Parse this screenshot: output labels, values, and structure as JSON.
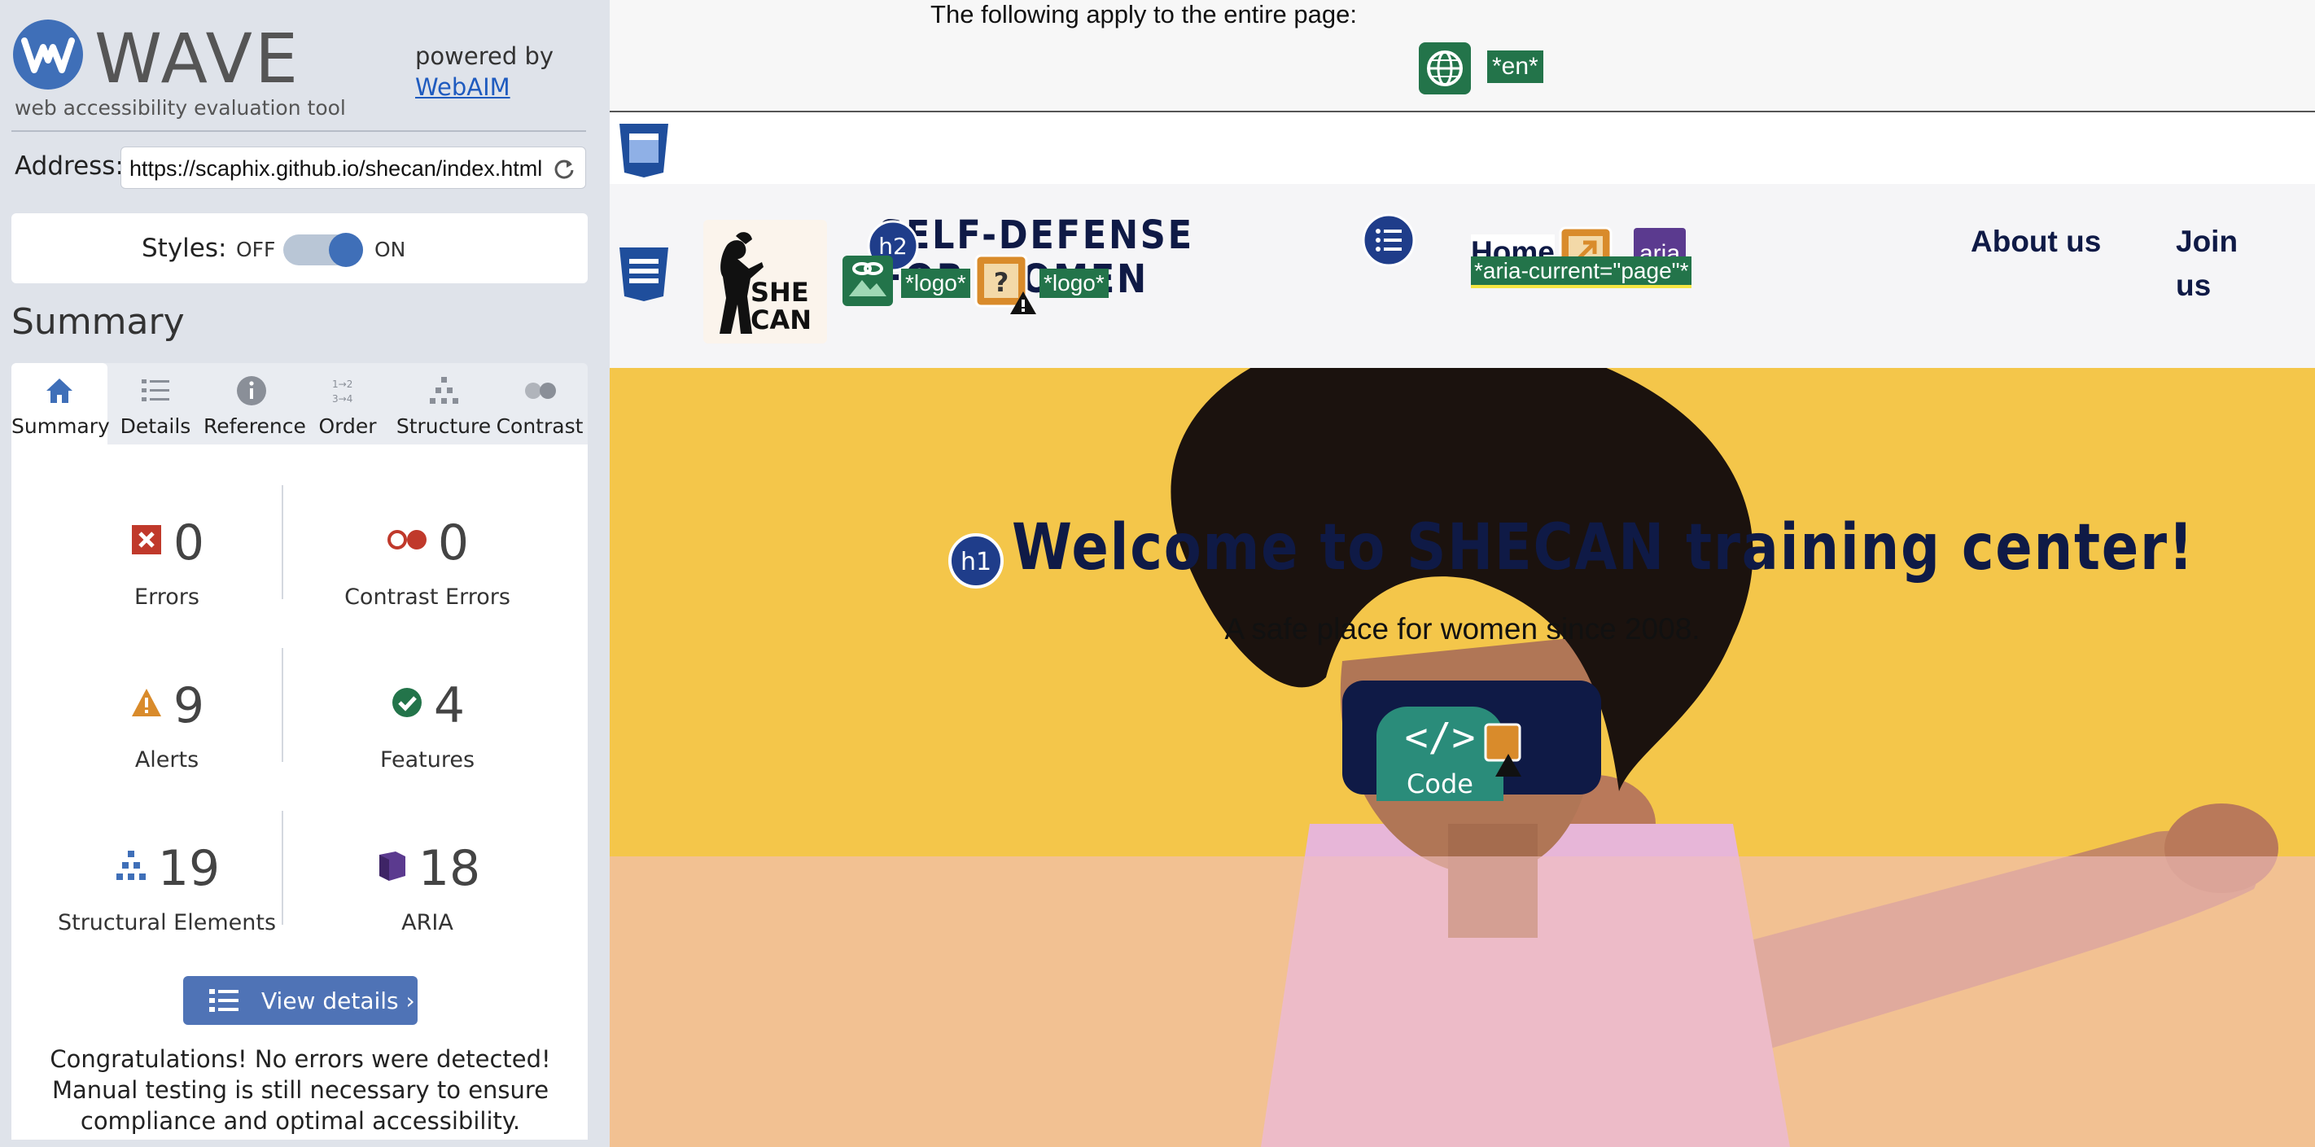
{
  "wave": {
    "name": "WAVE",
    "tagline": "web accessibility evaluation tool",
    "powered_by": "powered by",
    "powered_link": "WebAIM",
    "address_label": "Address:",
    "address_value": "https://scaphix.github.io/shecan/index.html",
    "styles_label": "Styles:",
    "styles_off": "OFF",
    "styles_on": "ON",
    "summary_heading": "Summary",
    "tabs": [
      {
        "label": "Summary",
        "icon": "home-icon"
      },
      {
        "label": "Details",
        "icon": "list-icon"
      },
      {
        "label": "Reference",
        "icon": "info-icon"
      },
      {
        "label": "Order",
        "icon": "order-icon"
      },
      {
        "label": "Structure",
        "icon": "structure-icon"
      },
      {
        "label": "Contrast",
        "icon": "contrast-icon"
      }
    ],
    "stats": {
      "errors": {
        "count": "0",
        "label": "Errors"
      },
      "contrast_errors": {
        "count": "0",
        "label": "Contrast Errors"
      },
      "alerts": {
        "count": "9",
        "label": "Alerts"
      },
      "features": {
        "count": "4",
        "label": "Features"
      },
      "structural": {
        "count": "19",
        "label": "Structural Elements"
      },
      "aria": {
        "count": "18",
        "label": "ARIA"
      }
    },
    "view_details": "View details ›",
    "congrats": "Congratulations! No errors were detected! Manual testing is still necessary to ensure compliance and optimal accessibility."
  },
  "page": {
    "banner_text": "The following apply to the entire page:",
    "lang_tag": "*en*",
    "logo_text": "SHE\nCAN",
    "site_title": "SELF-DEFENSE FOR WOMEN",
    "logo_tag_1": "*logo*",
    "logo_tag_2": "*logo*",
    "h2_badge": "h2",
    "nav": {
      "home": "Home",
      "about": "About us",
      "join": "Join us"
    },
    "aria_icon": "aria",
    "aria_tag": "*aria-current=\"page\"*",
    "h1_badge": "h1",
    "hero_title": "Welcome to SHECAN training center!",
    "hero_subtitle": "A safe place for women since 2008.",
    "code_label": "Code"
  },
  "colors": {
    "wave_blue": "#3f6fb8",
    "feature_green": "#23744a",
    "aria_purple": "#5b3a8f",
    "alert_orange": "#d98b2b",
    "error_red": "#c0392b",
    "site_navy": "#0f1a46",
    "hero_yellow": "#f4c64a"
  }
}
